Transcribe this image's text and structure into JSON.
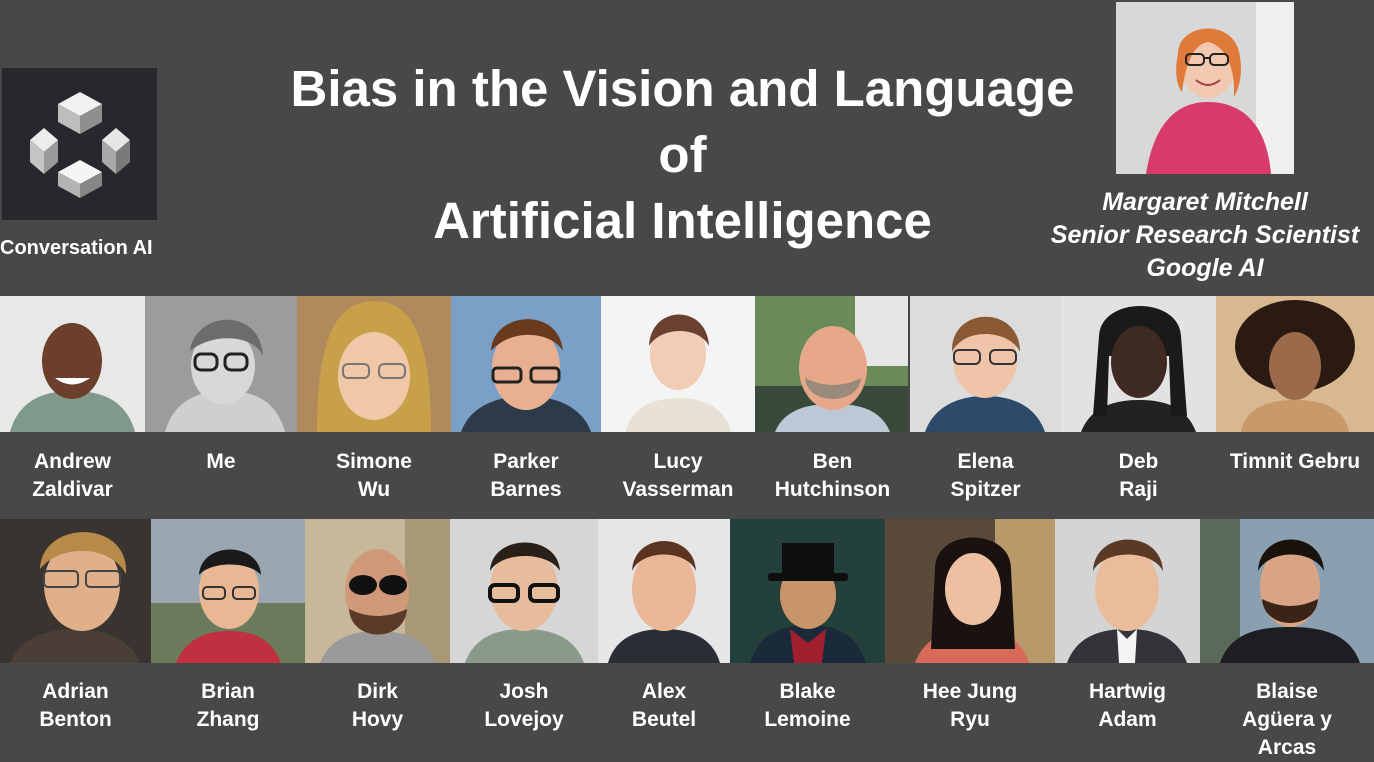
{
  "logo": {
    "label": "Conversation AI",
    "icon": "conversation-ai-cube-icon"
  },
  "title": {
    "line1": "Bias in the Vision and Language",
    "line2": "of",
    "line3": "Artificial Intelligence"
  },
  "speaker": {
    "name": "Margaret Mitchell",
    "role": "Senior Research Scientist",
    "org": "Google AI"
  },
  "team_row1": [
    {
      "line1": "Andrew",
      "line2": "Zaldivar"
    },
    {
      "line1": "Me",
      "line2": ""
    },
    {
      "line1": "Simone",
      "line2": "Wu"
    },
    {
      "line1": "Parker",
      "line2": "Barnes"
    },
    {
      "line1": "Lucy",
      "line2": "Vasserman"
    },
    {
      "line1": "Ben",
      "line2": "Hutchinson"
    },
    {
      "line1": "Elena",
      "line2": "Spitzer"
    },
    {
      "line1": "Deb",
      "line2": "Raji"
    },
    {
      "line1": "Timnit Gebru",
      "line2": ""
    }
  ],
  "team_row2": [
    {
      "line1": "Adrian",
      "line2": "Benton",
      "line3": ""
    },
    {
      "line1": "Brian",
      "line2": "Zhang",
      "line3": ""
    },
    {
      "line1": "Dirk",
      "line2": "Hovy",
      "line3": ""
    },
    {
      "line1": "Josh",
      "line2": "Lovejoy",
      "line3": ""
    },
    {
      "line1": "Alex",
      "line2": "Beutel",
      "line3": ""
    },
    {
      "line1": "Blake",
      "line2": "Lemoine",
      "line3": ""
    },
    {
      "line1": "Hee Jung",
      "line2": "Ryu",
      "line3": ""
    },
    {
      "line1": "Hartwig",
      "line2": "Adam",
      "line3": ""
    },
    {
      "line1": "Blaise",
      "line2": "Agüera y",
      "line3": "Arcas"
    }
  ]
}
